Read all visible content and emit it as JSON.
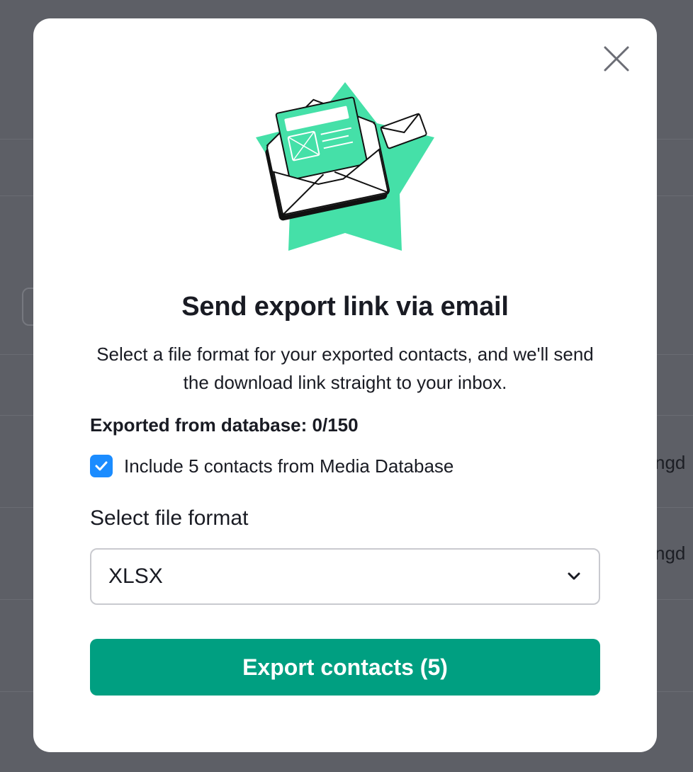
{
  "background": {
    "row_text_1": "ngd",
    "row_text_2": "ngd"
  },
  "dialog": {
    "close_icon": "close-icon",
    "illustration_icon": "envelope-illustration-icon",
    "title": "Send export link via email",
    "subtitle": "Select a file format for your exported contacts, and we'll send the download link straight to your inbox.",
    "exported_label": "Exported from database: 0/150",
    "include_checkbox": {
      "checked": true,
      "label": "Include 5 contacts from Media Database"
    },
    "format_label": "Select file format",
    "format_select": {
      "value": "XLSX",
      "icon": "chevron-down-icon"
    },
    "export_button": "Export contacts (5)"
  },
  "colors": {
    "accent": "#009f81",
    "checkbox": "#1b8cff",
    "illustration_green": "#45e0a8",
    "backdrop": "#5d5f66"
  }
}
